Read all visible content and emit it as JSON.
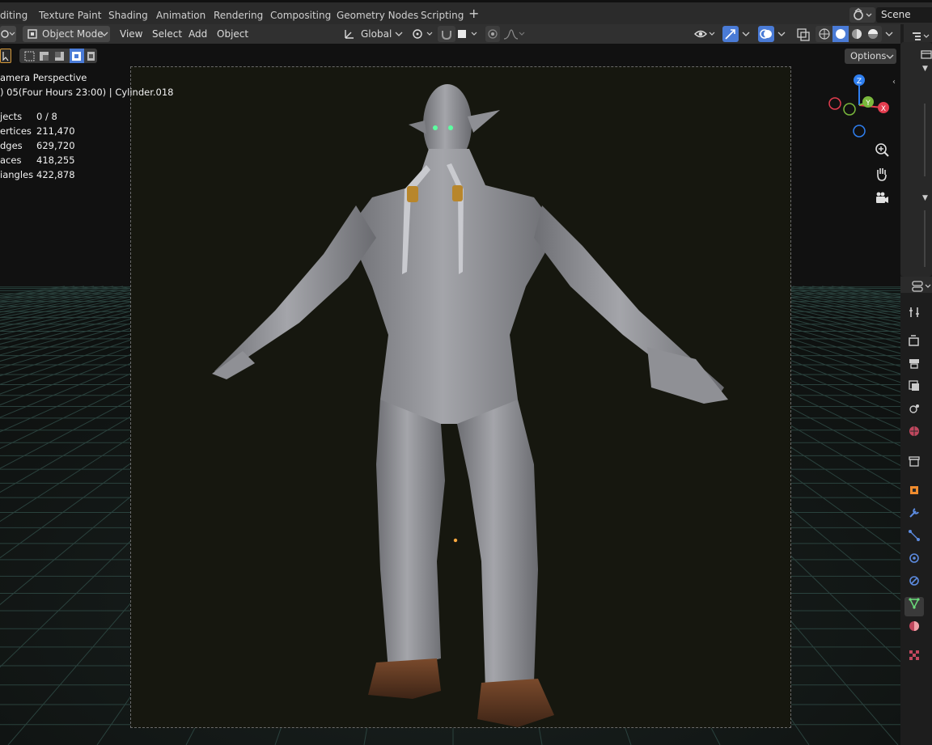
{
  "workspace_tabs": [
    "diting",
    "Texture Paint",
    "Shading",
    "Animation",
    "Rendering",
    "Compositing",
    "Geometry Nodes",
    "Scripting"
  ],
  "add_workspace_label": "+",
  "scene": {
    "label": "Scene"
  },
  "header": {
    "mode": "Object Mode",
    "menus": [
      "View",
      "Select",
      "Add",
      "Object"
    ],
    "transform_orientation": "Global"
  },
  "options_label": "Options",
  "overlay": {
    "view_name": "amera Perspective",
    "collection_line": ") 05(Four Hours 23:00) | Cylinder.018",
    "stats": [
      {
        "label": "jects",
        "value": "0 / 8"
      },
      {
        "label": "ertices",
        "value": "211,470"
      },
      {
        "label": "dges",
        "value": "629,720"
      },
      {
        "label": "aces",
        "value": "418,255"
      },
      {
        "label": "iangles",
        "value": "422,878"
      }
    ]
  },
  "gizmo": {
    "axes": [
      "Z",
      "Y",
      "X"
    ]
  },
  "colors": {
    "x_axis": "#e33d4f",
    "y_axis": "#7ab83c",
    "z_axis": "#2f7ff0",
    "accent": "#4a7bd6",
    "mesh": "#9a9ba0",
    "hooves": "#5a3420",
    "bands": "#b8862b"
  }
}
